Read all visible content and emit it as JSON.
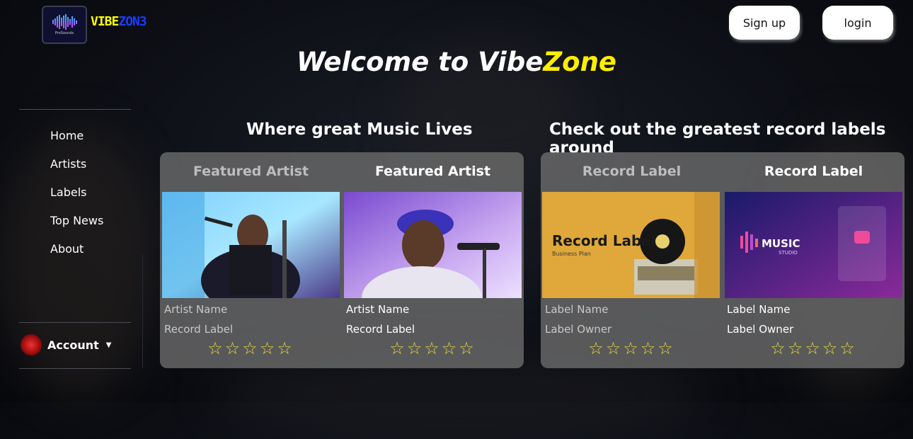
{
  "header": {
    "logo_subtext": "ProSounds",
    "brand_part1": "VIBE",
    "brand_part2": "ZON3",
    "signup_label": "Sign up",
    "login_label": "login"
  },
  "hero": {
    "title_part1": "Welcome to Vibe",
    "title_part2": "Zone"
  },
  "sidebar": {
    "items": [
      {
        "label": "Home"
      },
      {
        "label": "Artists"
      },
      {
        "label": "Labels"
      },
      {
        "label": "Top News"
      },
      {
        "label": "About"
      }
    ],
    "account_label": "Account"
  },
  "artists_section": {
    "title": "Where great Music Lives",
    "cards": [
      {
        "title": "Featured Artist",
        "line1": "Artist Name",
        "line2": "Record Label",
        "stars": "☆☆☆☆☆"
      },
      {
        "title": "Featured Artist",
        "line1": "Artist Name",
        "line2": "Record Label",
        "stars": "☆☆☆☆☆"
      }
    ]
  },
  "labels_section": {
    "title": "Check out the greatest record labels around",
    "cards": [
      {
        "title": "Record Label",
        "line1": "Label Name",
        "line2": "Label Owner",
        "stars": "☆☆☆☆☆",
        "image_heading": "Record Label",
        "image_sub": "Business Plan"
      },
      {
        "title": "Record Label",
        "line1": "Label Name",
        "line2": "Label Owner",
        "stars": "☆☆☆☆☆",
        "image_heading": "MUSIC",
        "image_sub": "STUDIO"
      }
    ]
  },
  "colors": {
    "accent_yellow": "#ffee00",
    "brand_blue": "#1a3cff",
    "star": "#e8d840"
  }
}
